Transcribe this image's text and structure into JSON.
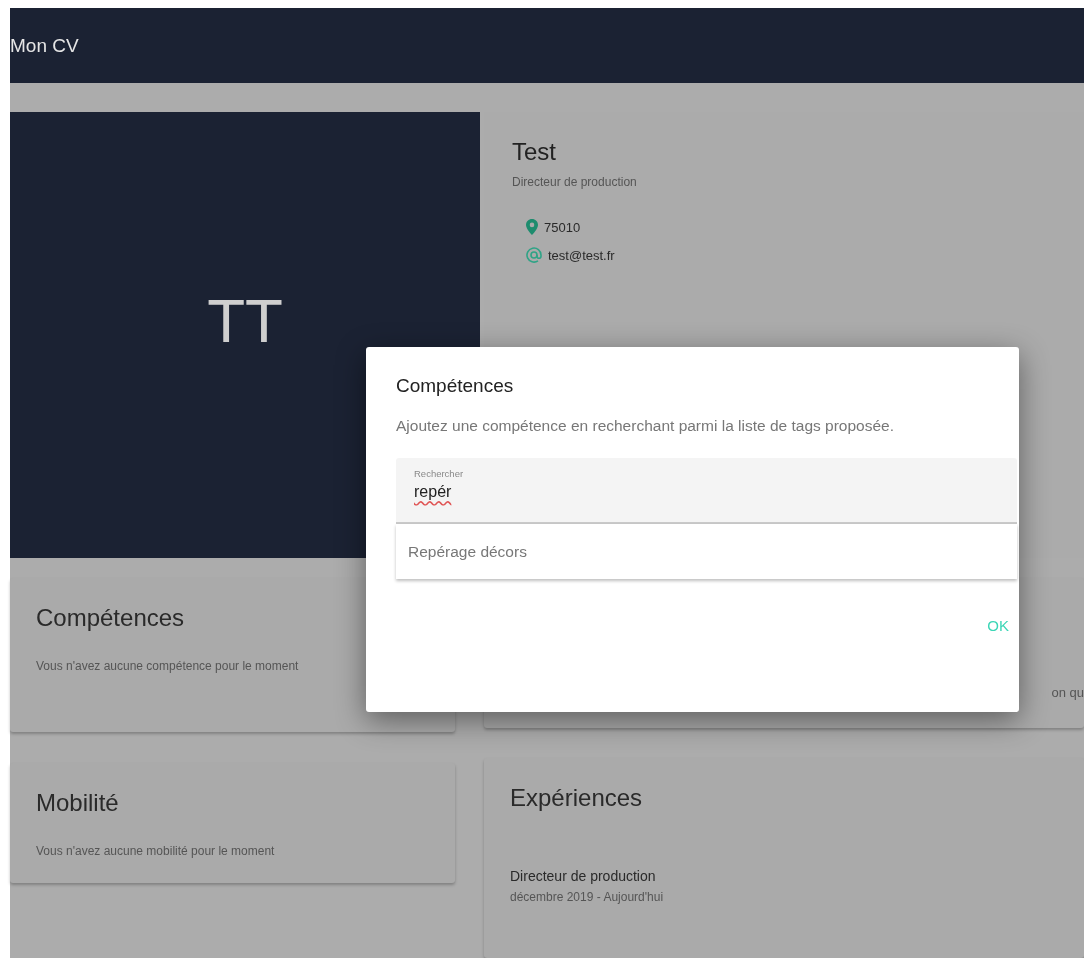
{
  "app_bar": {
    "title": "Mon CV"
  },
  "profile": {
    "initials": "TT",
    "name": "Test",
    "job_title": "Directeur de production",
    "location": "75010",
    "email": "test@test.fr"
  },
  "skills_card": {
    "title": "Compétences",
    "empty_text": "Vous n'avez aucune compétence pour le moment"
  },
  "about_card": {
    "text_fragment": "on qu"
  },
  "mobility_card": {
    "title": "Mobilité",
    "empty_text": "Vous n'avez aucune mobilité pour le moment"
  },
  "experiences": {
    "title": "Expériences",
    "items": [
      {
        "title": "Directeur de production",
        "period": "décembre 2019 - Aujourd'hui"
      }
    ]
  },
  "dialog": {
    "title": "Compétences",
    "description": "Ajoutez une compétence en recherchant parmi la liste de tags proposée.",
    "search": {
      "label": "Rechercher",
      "value": "repér"
    },
    "suggestions": [
      "Repérage décors"
    ],
    "buttons": [
      "OK"
    ]
  }
}
